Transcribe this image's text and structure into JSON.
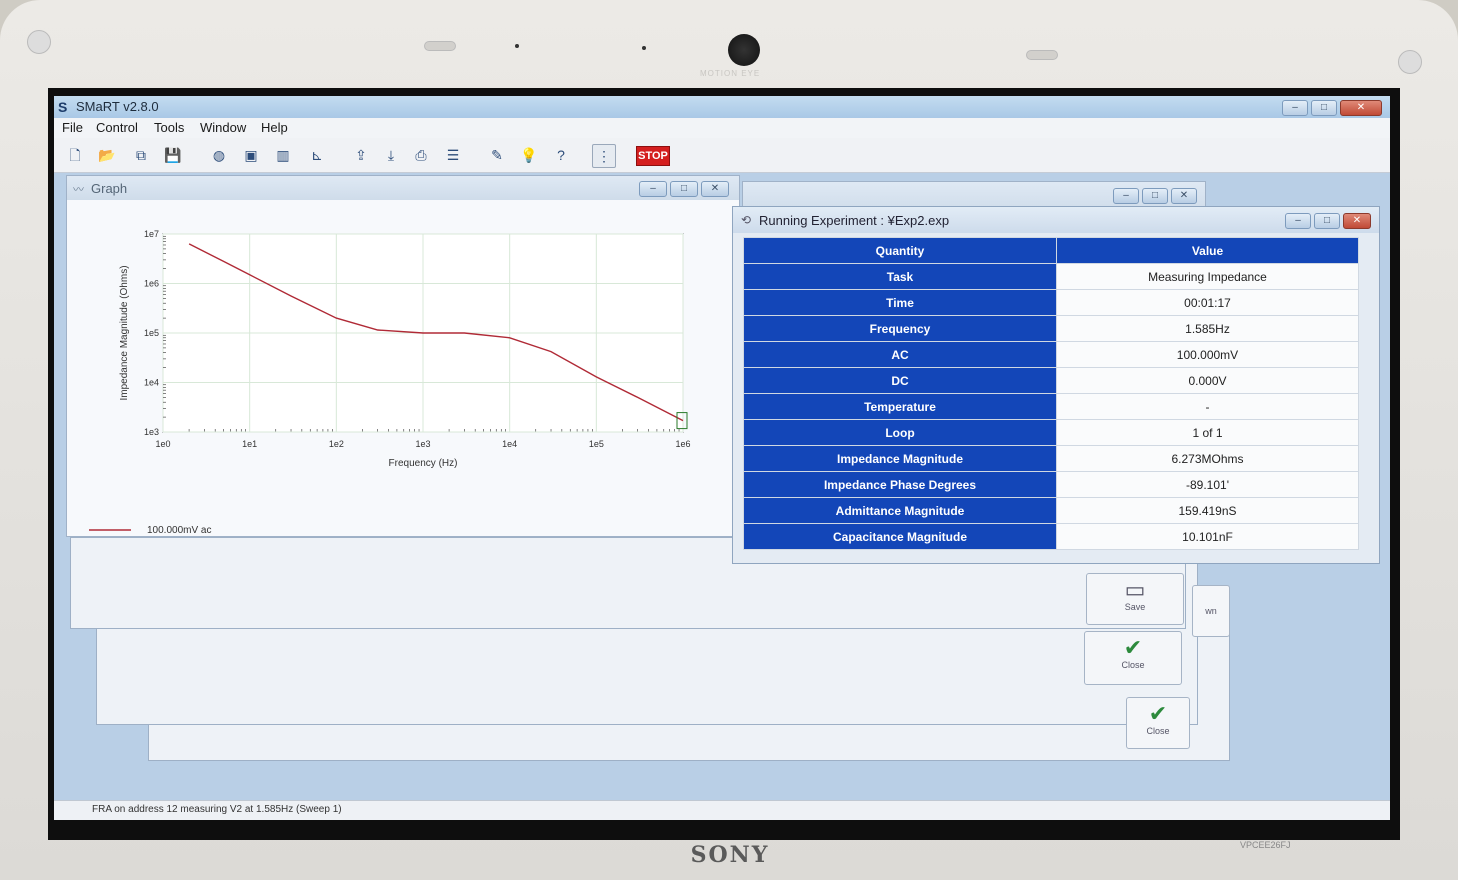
{
  "device": {
    "brand": "SONY",
    "model": "VPCEE26FJ",
    "camera_label": "MOTION EYE"
  },
  "app": {
    "title": "SMaRT v2.8.0",
    "menu": [
      "File",
      "Control",
      "Tools",
      "Window",
      "Help"
    ],
    "toolbar": {
      "icons": [
        "new-file-icon",
        "open-folder-icon",
        "copy-icon",
        "save-icon",
        "globe-icon",
        "monitor-icon",
        "chart-bars-icon",
        "axis-icon",
        "export-icon",
        "import-icon",
        "print-icon",
        "layout-icon",
        "pen-icon",
        "lightbulb-icon",
        "help-question-icon",
        "traffic-light-icon"
      ],
      "stop_label": "STOP"
    },
    "window_controls": {
      "minimize": "–",
      "maximize": "□",
      "close": "✕"
    },
    "status_text": "FRA on address 12 measuring V2 at 1.585Hz (Sweep 1)"
  },
  "graph_window": {
    "title": "Graph"
  },
  "chart_data": {
    "type": "line",
    "xlabel": "Frequency (Hz)",
    "ylabel": "Impedance Magnitude (Ohms)",
    "x_scale": "log",
    "y_scale": "log",
    "xlim": [
      1,
      1000000
    ],
    "ylim": [
      1000,
      10000000
    ],
    "x_ticks": [
      "1e0",
      "1e1",
      "1e2",
      "1e3",
      "1e4",
      "1e5",
      "1e6"
    ],
    "y_ticks": [
      "1e3",
      "1e4",
      "1e5",
      "1e6",
      "1e7"
    ],
    "grid": true,
    "legend_position": "bottom-left",
    "series": [
      {
        "name": "100.000mV ac",
        "color": "#b02a36",
        "x": [
          2,
          5,
          10,
          30,
          100,
          300,
          1000,
          3000,
          10000,
          30000,
          100000,
          300000,
          1000000
        ],
        "y": [
          6300000,
          2800000,
          1500000,
          560000,
          200000,
          115000,
          100000,
          100000,
          80000,
          42000,
          13000,
          5000,
          1700
        ]
      }
    ]
  },
  "background_windows": {
    "save_button": "Save",
    "close_button": "Close",
    "close_button_2": "Close",
    "partial_label": "wn"
  },
  "experiment_window": {
    "title": "Running Experiment : ¥Exp2.exp",
    "header": {
      "quantity": "Quantity",
      "value": "Value"
    },
    "rows": [
      {
        "quantity": "Task",
        "value": "Measuring Impedance"
      },
      {
        "quantity": "Time",
        "value": "00:01:17"
      },
      {
        "quantity": "Frequency",
        "value": "1.585Hz"
      },
      {
        "quantity": "AC",
        "value": "100.000mV"
      },
      {
        "quantity": "DC",
        "value": "0.000V"
      },
      {
        "quantity": "Temperature",
        "value": "-"
      },
      {
        "quantity": "Loop",
        "value": "1 of 1"
      },
      {
        "quantity": "Impedance Magnitude",
        "value": "6.273MOhms"
      },
      {
        "quantity": "Impedance Phase Degrees",
        "value": "-89.101'"
      },
      {
        "quantity": "Admittance Magnitude",
        "value": "159.419nS"
      },
      {
        "quantity": "Capacitance Magnitude",
        "value": "10.101nF"
      }
    ]
  }
}
